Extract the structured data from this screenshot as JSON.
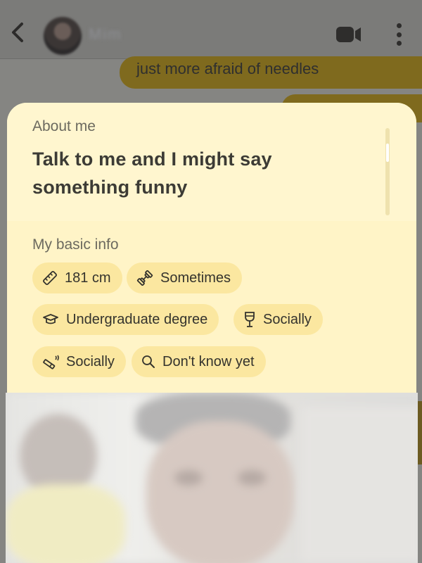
{
  "chat": {
    "contact_name": "Mim",
    "messages": [
      {
        "text": "just more afraid of needles"
      },
      {
        "text": ""
      }
    ]
  },
  "profile": {
    "about_label": "About me",
    "about_text": "Talk to me and I might say something funny",
    "basic_info_label": "My basic info",
    "chips": [
      {
        "icon": "ruler-icon",
        "label": "181 cm"
      },
      {
        "icon": "dumbbell-icon",
        "label": "Sometimes"
      },
      {
        "icon": "graduation-cap-icon",
        "label": "Undergraduate degree"
      },
      {
        "icon": "wine-glass-icon",
        "label": "Socially"
      },
      {
        "icon": "smoking-icon",
        "label": "Socially"
      },
      {
        "icon": "search-icon",
        "label": "Don't know yet"
      }
    ]
  },
  "colors": {
    "sheet_background": "#fff4c7",
    "chip_background": "#fbe7a0",
    "bubble_dimmed": "#7f6a1e"
  }
}
